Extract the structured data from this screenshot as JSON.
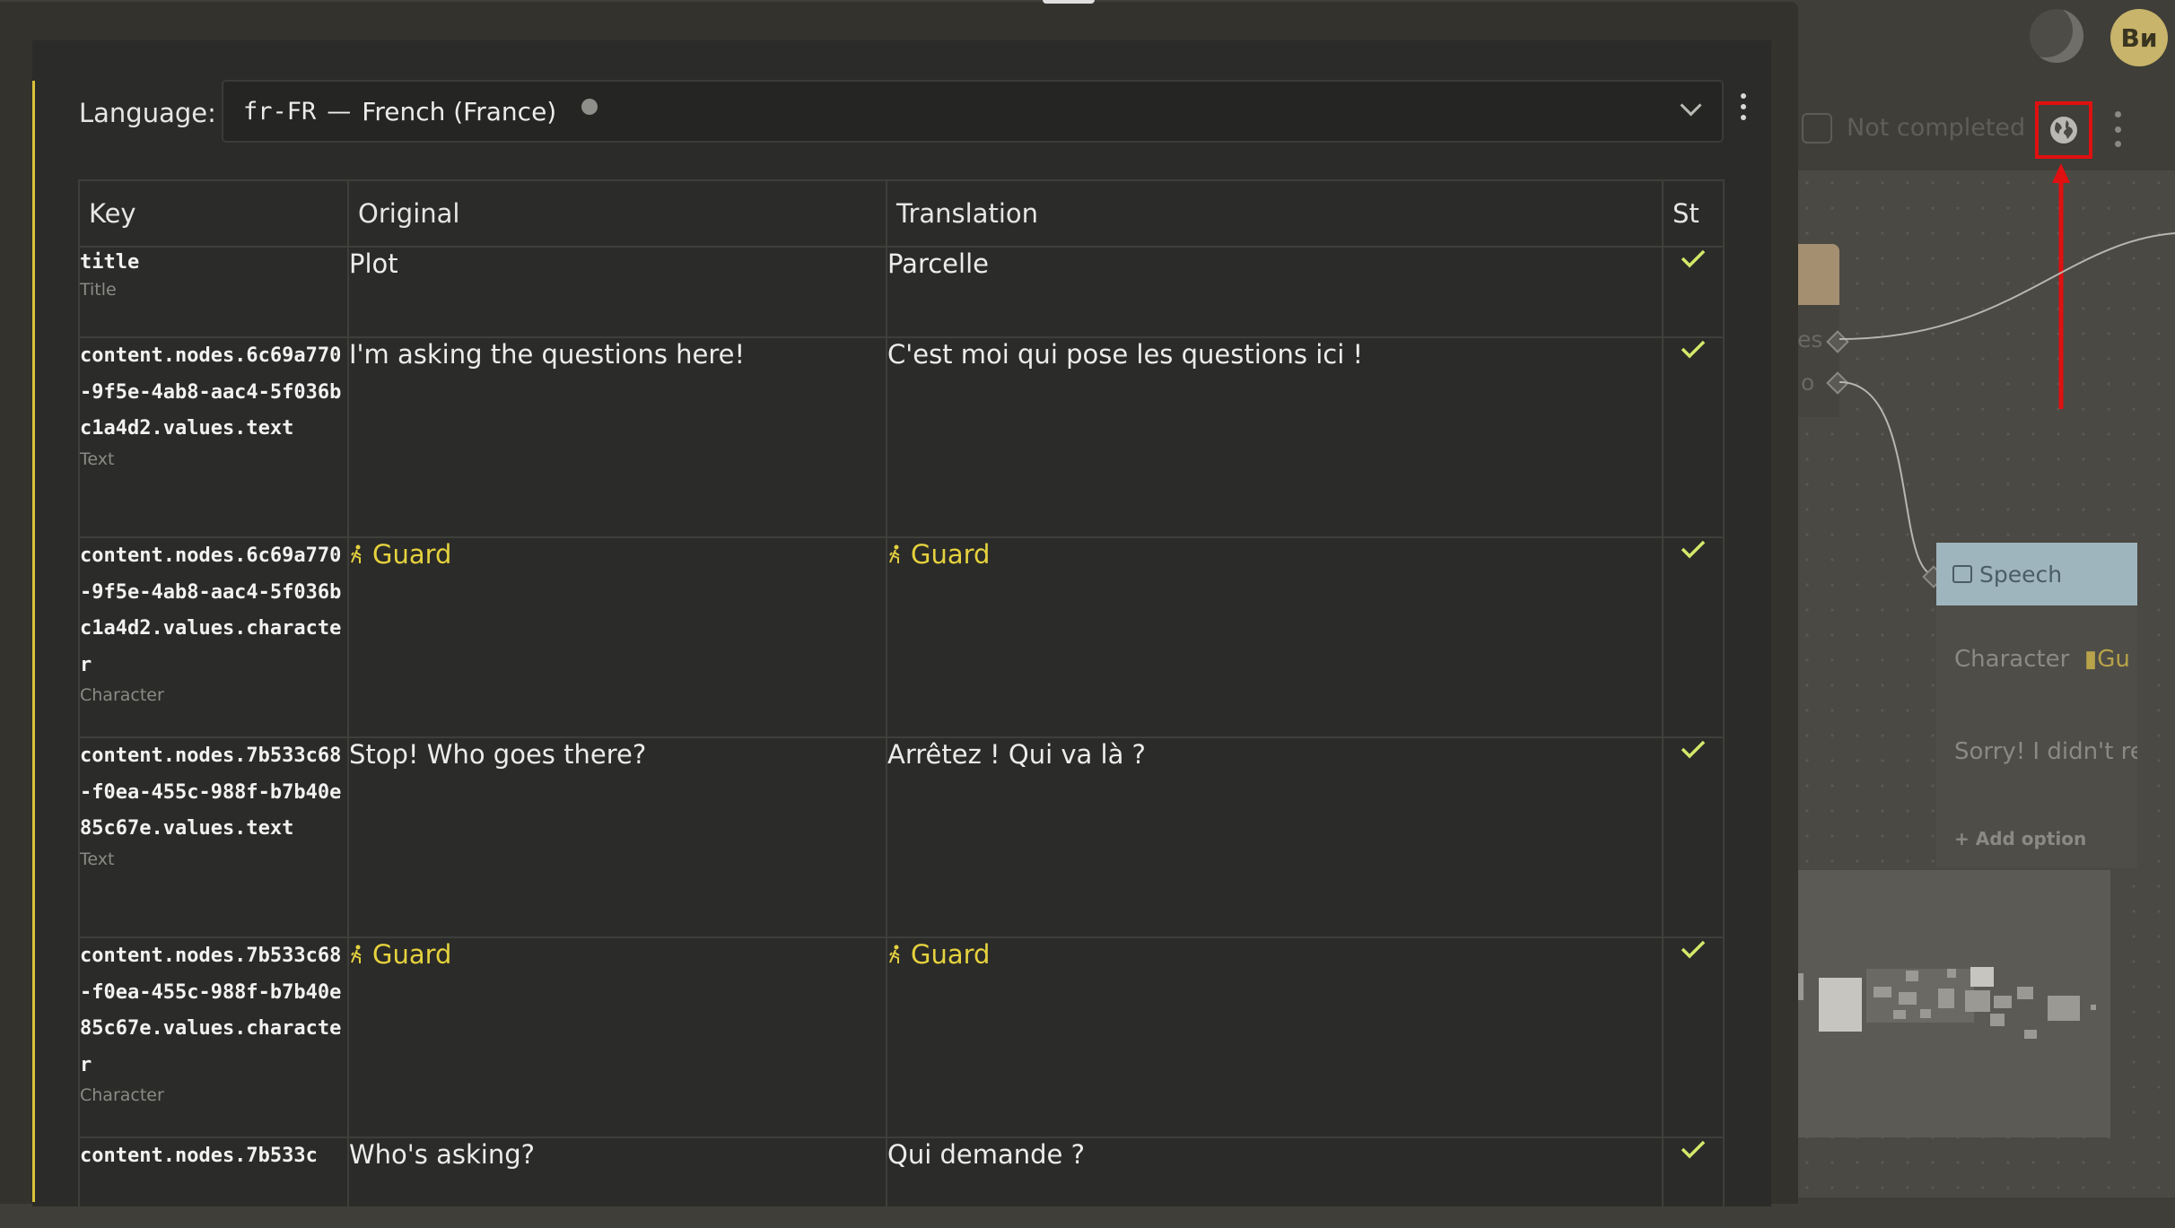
{
  "header": {
    "user_initials": "Ви",
    "not_completed_label": "Not completed"
  },
  "canvas": {
    "frag1": "es",
    "frag2": "o",
    "speech_node": {
      "title": "Speech",
      "character_label": "Character",
      "character_value": "Gu",
      "text_preview": "Sorry! I didn't re",
      "add_option": "+ Add option"
    }
  },
  "dialog": {
    "language_label": "Language:",
    "language_code": "fr-FR",
    "language_separator": "—",
    "language_name": "French (France)",
    "columns": [
      "Key",
      "Original",
      "Translation",
      "St"
    ],
    "rows": [
      {
        "key": "title",
        "type": "Title",
        "original": "Plot",
        "translation": "Parcelle",
        "status": "done"
      },
      {
        "key": "content.nodes.6c69a770-9f5e-4ab8-aac4-5f036bc1a4d2.values.text",
        "type": "Text",
        "original": "I'm asking the questions here!",
        "translation": "C'est moi qui pose les questions ici !",
        "status": "done"
      },
      {
        "key": "content.nodes.6c69a770-9f5e-4ab8-aac4-5f036bc1a4d2.values.character",
        "type": "Character",
        "original": "Guard",
        "translation": "Guard",
        "status": "done"
      },
      {
        "key": "content.nodes.7b533c68-f0ea-455c-988f-b7b40e85c67e.values.text",
        "type": "Text",
        "original": "Stop! Who goes there?",
        "translation": "Arrêtez ! Qui va là ?",
        "status": "done"
      },
      {
        "key": "content.nodes.7b533c68-f0ea-455c-988f-b7b40e85c67e.values.character",
        "type": "Character",
        "original": "Guard",
        "translation": "Guard",
        "status": "done"
      },
      {
        "key": "content.nodes.7b533c",
        "type": "",
        "original": "Who's asking?",
        "translation": "Qui demande ?",
        "status": "done"
      }
    ]
  },
  "colors": {
    "accent": "#d8c23a",
    "character": "#e5d23e",
    "check": "#d4e86a",
    "highlight": "#e01010"
  },
  "icons": [
    "moon-icon",
    "globe-icon",
    "kebab-icon",
    "chevron-down-icon",
    "person-icon",
    "check-icon",
    "speech-icon"
  ]
}
